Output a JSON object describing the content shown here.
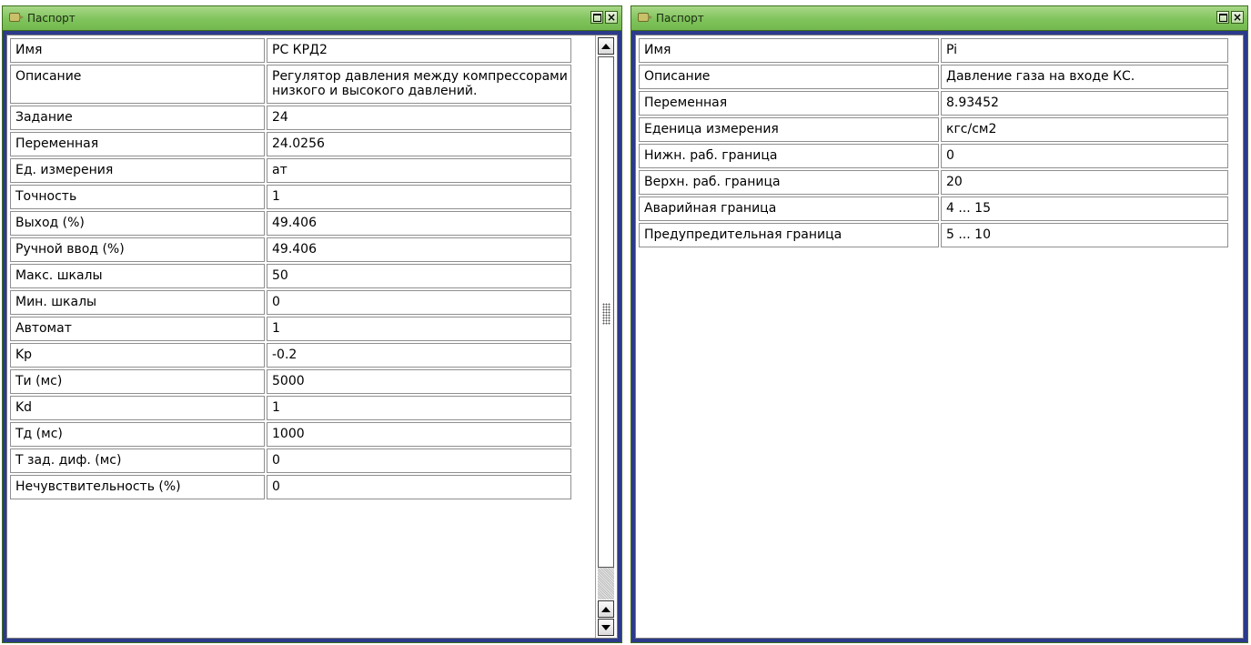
{
  "left_window": {
    "title": "Паспорт",
    "rows": [
      {
        "key": "Имя",
        "value": "РС КРД2"
      },
      {
        "key": "Описание",
        "value": "Регулятор давления между компрессорами низкого и высокого давлений."
      },
      {
        "key": "Задание",
        "value": "24"
      },
      {
        "key": "Переменная",
        "value": "24.0256"
      },
      {
        "key": "Ед. измерения",
        "value": "ат"
      },
      {
        "key": "Точность",
        "value": "1"
      },
      {
        "key": "Выход (%)",
        "value": "49.406"
      },
      {
        "key": "Ручной ввод (%)",
        "value": "49.406"
      },
      {
        "key": "Макс. шкалы",
        "value": "50"
      },
      {
        "key": "Мин. шкалы",
        "value": "0"
      },
      {
        "key": "Автомат",
        "value": "1"
      },
      {
        "key": "Kp",
        "value": "-0.2"
      },
      {
        "key": "Ти (мс)",
        "value": "5000"
      },
      {
        "key": "Kd",
        "value": "1"
      },
      {
        "key": "Тд (мс)",
        "value": "1000"
      },
      {
        "key": "Т зад. диф. (мс)",
        "value": "0"
      },
      {
        "key": "Нечувствительность (%)",
        "value": "0"
      }
    ]
  },
  "right_window": {
    "title": "Паспорт",
    "rows": [
      {
        "key": "Имя",
        "value": "Pi"
      },
      {
        "key": "Описание",
        "value": "Давление газа на входе КС."
      },
      {
        "key": "Переменная",
        "value": "8.93452"
      },
      {
        "key": "Еденица измерения",
        "value": "кгс/см2"
      },
      {
        "key": "Нижн. раб. граница",
        "value": "0"
      },
      {
        "key": "Верхн. раб. граница",
        "value": "20"
      },
      {
        "key": "Аварийная граница",
        "value": "4 ... 15"
      },
      {
        "key": "Предупредительная граница",
        "value": "5 ... 10"
      }
    ]
  },
  "titlebar_buttons": {
    "close": "×"
  },
  "colors": {
    "titlebar": "#80c35c",
    "window_border": "#2b3a8a",
    "cell_border": "#8f8f8f"
  }
}
